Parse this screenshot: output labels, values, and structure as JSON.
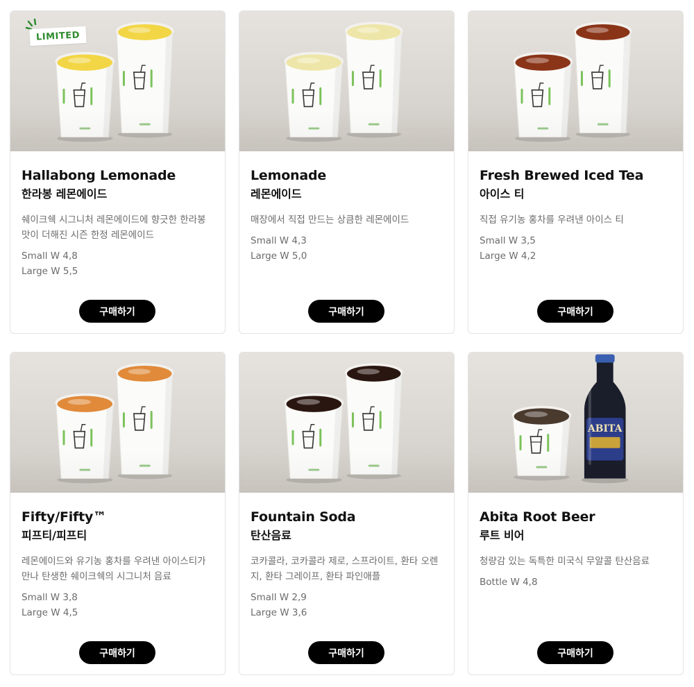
{
  "badge": {
    "label": "LIMITED",
    "color": "#2e8b2e"
  },
  "buy_label": "구매하기",
  "products": [
    {
      "name_en": "Hallabong Lemonade",
      "name_ko": "한라봉 레몬에이드",
      "desc": "쉐이크쉑 시그니처 레몬에이드에 향긋한 한라봉 맛이 더해진 시즌 한정 레몬에이드",
      "prices": [
        "Small W 4,8",
        "Large W 5,5"
      ],
      "drink_color": "#f2d645",
      "limited": true,
      "image": "cups"
    },
    {
      "name_en": "Lemonade",
      "name_ko": "레몬에이드",
      "desc": "매장에서 직접 만드는 상큼한 레몬에이드",
      "prices": [
        "Small W 4,3",
        "Large W 5,0"
      ],
      "drink_color": "#eee6a8",
      "limited": false,
      "image": "cups"
    },
    {
      "name_en": "Fresh Brewed Iced Tea",
      "name_ko": "아이스 티",
      "desc": "직접 유기농 홍차를 우려낸 아이스 티",
      "prices": [
        "Small W 3,5",
        "Large W 4,2"
      ],
      "drink_color": "#8a3418",
      "limited": false,
      "image": "cups"
    },
    {
      "name_en": "Fifty/Fifty™",
      "name_ko": "피프티/피프티",
      "desc": "레몬에이드와 유기농 홍차를 우려낸 아이스티가 만나 탄생한 쉐이크쉑의 시그니처 음료",
      "prices": [
        "Small W 3,8",
        "Large W 4,5"
      ],
      "drink_color": "#e08a3a",
      "limited": false,
      "image": "cups"
    },
    {
      "name_en": "Fountain Soda",
      "name_ko": "탄산음료",
      "desc": "코카콜라, 코카콜라 제로, 스프라이트, 환타 오렌지, 환타 그레이프, 환타 파인애플",
      "prices": [
        "Small W 2,9",
        "Large W 3,6"
      ],
      "drink_color": "#2a1610",
      "limited": false,
      "image": "cups"
    },
    {
      "name_en": "Abita Root Beer",
      "name_ko": "루트 비어",
      "desc": "청량감 있는 독특한 미국식 무알콜 탄산음료",
      "prices": [
        "Bottle W 4,8"
      ],
      "drink_color": "#4a3a2e",
      "limited": false,
      "image": "bottle",
      "bottle_label": "ABITA"
    }
  ]
}
